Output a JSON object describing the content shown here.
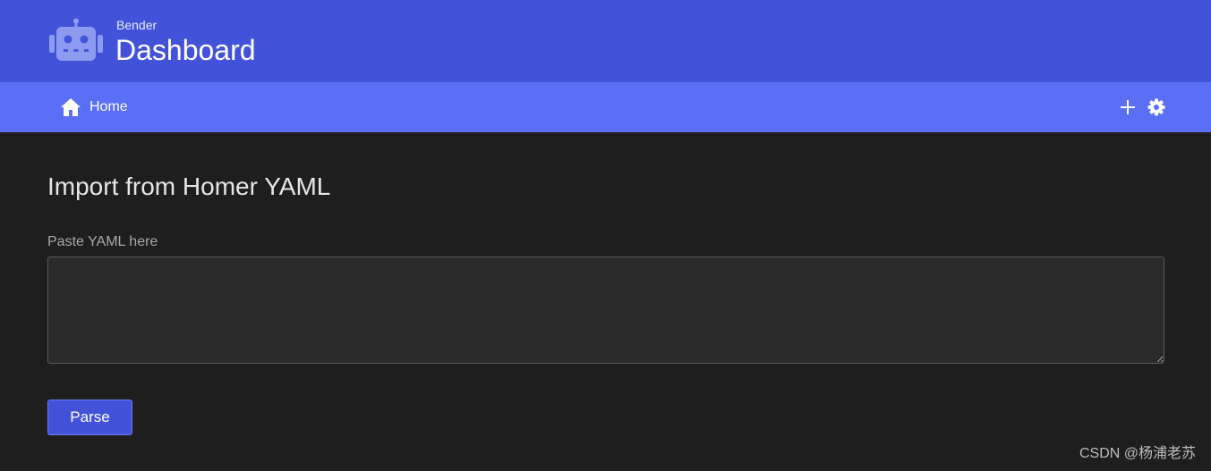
{
  "header": {
    "subtitle": "Bender",
    "title": "Dashboard",
    "logo_icon": "robot-icon"
  },
  "navbar": {
    "home": {
      "label": "Home",
      "icon": "home-icon"
    },
    "actions": [
      {
        "icon": "plus-icon"
      },
      {
        "icon": "gear-icon"
      }
    ]
  },
  "main": {
    "heading": "Import from Homer YAML",
    "field_label": "Paste YAML here",
    "yaml_value": "",
    "parse_label": "Parse"
  },
  "watermark": "CSDN @杨浦老苏",
  "colors": {
    "header_bg": "#4353d9",
    "navbar_bg": "#5a6ff5",
    "page_bg": "#1e1e1e",
    "input_bg": "#2a2a2a",
    "button_bg": "#4353d9"
  }
}
